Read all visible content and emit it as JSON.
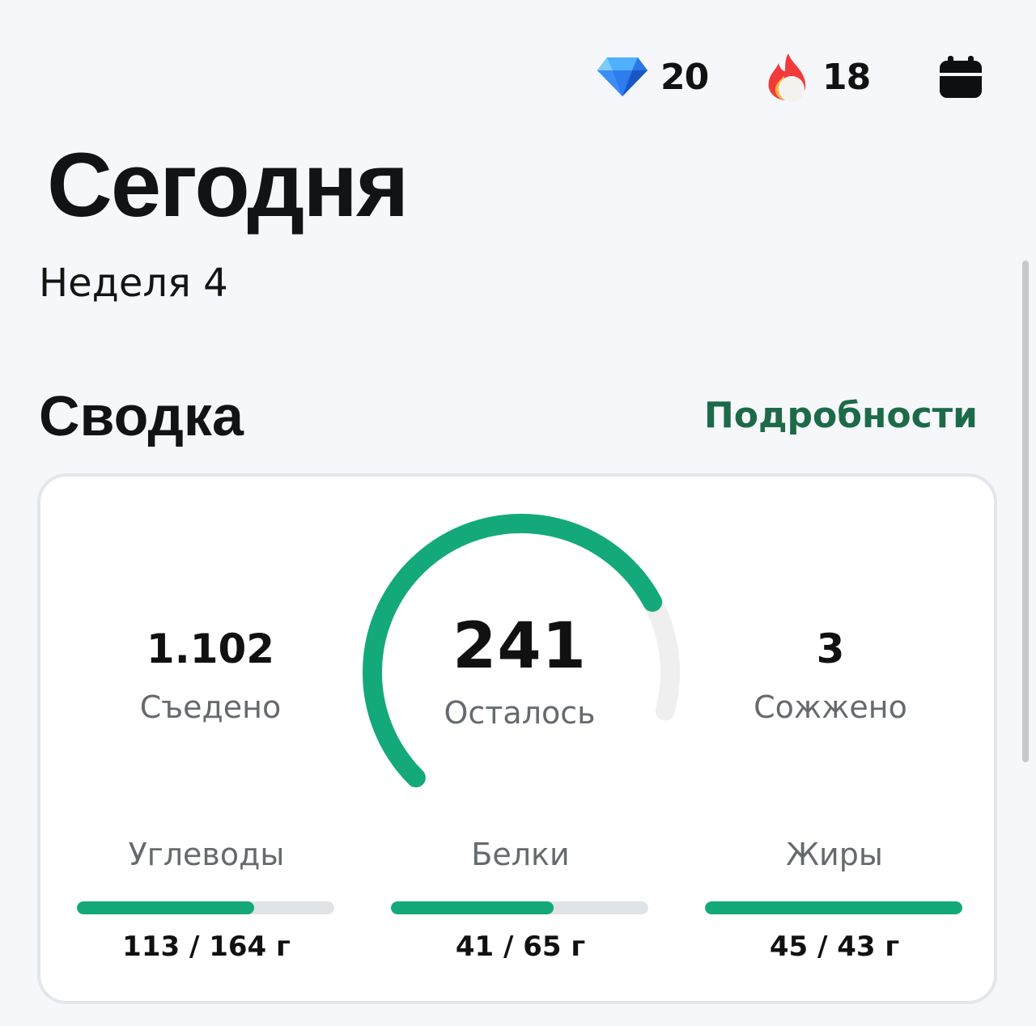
{
  "topbar": {
    "gems": {
      "icon": "diamond-icon",
      "value": "20"
    },
    "streak": {
      "icon": "flame-icon",
      "value": "18"
    },
    "calendar": {
      "icon": "calendar-icon"
    }
  },
  "header": {
    "title": "Сегодня",
    "subtitle": "Неделя 4"
  },
  "summary": {
    "title": "Сводка",
    "details_label": "Подробности",
    "eaten": {
      "value": "1.102",
      "label": "Съедено"
    },
    "remaining": {
      "value": "241",
      "label": "Осталось"
    },
    "burned": {
      "value": "3",
      "label": "Сожжено"
    },
    "gauge_progress": 0.82,
    "macros": [
      {
        "label": "Углеводы",
        "value": "113 / 164 г",
        "current": 113,
        "goal": 164
      },
      {
        "label": "Белки",
        "value": "41 / 65 г",
        "current": 41,
        "goal": 65
      },
      {
        "label": "Жиры",
        "value": "45 / 43 г",
        "current": 45,
        "goal": 43
      }
    ]
  },
  "colors": {
    "accent": "#14a97a",
    "link": "#1d6a48",
    "track": "#e1e4e6",
    "background": "#f5f7fa"
  }
}
